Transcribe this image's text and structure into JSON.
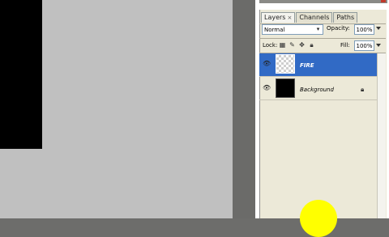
{
  "tabs": [
    {
      "label": "Layers",
      "close": "×",
      "active": true
    },
    {
      "label": "Channels",
      "active": false
    },
    {
      "label": "Paths",
      "active": false
    }
  ],
  "options": {
    "blend_mode": "Normal",
    "opacity_label": "Opacity:",
    "opacity_value": "100%"
  },
  "lock": {
    "label": "Lock:",
    "icons": [
      "lock-transparency-icon",
      "lock-brush-icon",
      "lock-move-icon",
      "lock-all-icon"
    ],
    "fill_label": "Fill:",
    "fill_value": "100%"
  },
  "layers": [
    {
      "name": "FIRE",
      "selected": true,
      "visible": true,
      "thumbnail": "transparent"
    },
    {
      "name": "Background",
      "selected": false,
      "visible": true,
      "thumbnail": "black",
      "locked": true
    }
  ],
  "colors": {
    "selection": "#316ac5",
    "canvas": "#c0c0c0",
    "cursor_highlight": "#ffff00"
  }
}
